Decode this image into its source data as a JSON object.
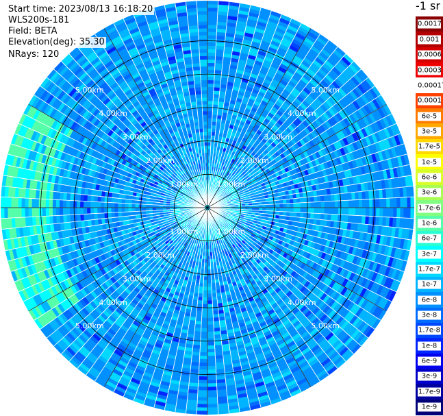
{
  "header": {
    "start_time": "Start time: 2023/08/13 16:18:20",
    "device": "WLS200s-181",
    "field": "Field: BETA",
    "elevation": "Elevation(deg): 35.30",
    "nrays": "NRays: 120"
  },
  "colorbar": {
    "title": "-1 sr",
    "entries": [
      {
        "label": "0.0017",
        "color": "#8b0000"
      },
      {
        "label": "0.001",
        "color": "#b20000"
      },
      {
        "label": "0.0006",
        "color": "#d40000"
      },
      {
        "label": "0.0003",
        "color": "#ee0000"
      },
      {
        "label": "0.00017",
        "color": "#ffffff"
      },
      {
        "label": "0.0001",
        "color": "#ff4000"
      },
      {
        "label": "6e-5",
        "color": "#ff7a00"
      },
      {
        "label": "3e-5",
        "color": "#ffa800"
      },
      {
        "label": "1.7e-5",
        "color": "#ffd800"
      },
      {
        "label": "1e-5",
        "color": "#ffff00"
      },
      {
        "label": "6e-6",
        "color": "#d8ff2a"
      },
      {
        "label": "3e-6",
        "color": "#aaff55"
      },
      {
        "label": "1.7e-6",
        "color": "#80ff80"
      },
      {
        "label": "1e-6",
        "color": "#55ffaa"
      },
      {
        "label": "6e-7",
        "color": "#2affd4"
      },
      {
        "label": "3e-7",
        "color": "#00ffff"
      },
      {
        "label": "1.7e-7",
        "color": "#00d8ff"
      },
      {
        "label": "1e-7",
        "color": "#00b4ff"
      },
      {
        "label": "6e-8",
        "color": "#0090ff"
      },
      {
        "label": "3e-8",
        "color": "#006cff"
      },
      {
        "label": "1.7e-8",
        "color": "#0048ff"
      },
      {
        "label": "1e-8",
        "color": "#0024ff"
      },
      {
        "label": "6e-9",
        "color": "#0000ee"
      },
      {
        "label": "3e-9",
        "color": "#0000c8"
      },
      {
        "label": "1.7e-9",
        "color": "#0000a0"
      },
      {
        "label": "1e-9",
        "color": "#000078"
      }
    ]
  },
  "chart_data": {
    "type": "heatmap",
    "projection": "polar-ppi",
    "field": "BETA",
    "units": "-1 sr",
    "elevation_deg": 35.3,
    "n_rays": 120,
    "range_rings_km": [
      1,
      2,
      3,
      4,
      5
    ],
    "ring_labels": [
      "1.00km",
      "2.00km",
      "3.00km",
      "4.00km",
      "5.00km"
    ],
    "max_range_km": 6.2,
    "azimuth_spokes_deg": [
      0,
      30,
      60,
      90,
      120,
      150,
      180,
      210,
      240,
      270,
      300,
      330
    ],
    "dominant_value_range": [
      1.7e-08,
      1e-07
    ],
    "west_sector_value_range": [
      3e-07,
      1e-06
    ],
    "west_sector_azimuth_deg": [
      235,
      300
    ],
    "west_sector_min_range_km": 4.7,
    "colors": {
      "background_blue": "#0090ff",
      "dark_speckle": "#0024ff",
      "light_speckle": "#00d8ff",
      "near_range_cyan": "#2affd4"
    }
  }
}
